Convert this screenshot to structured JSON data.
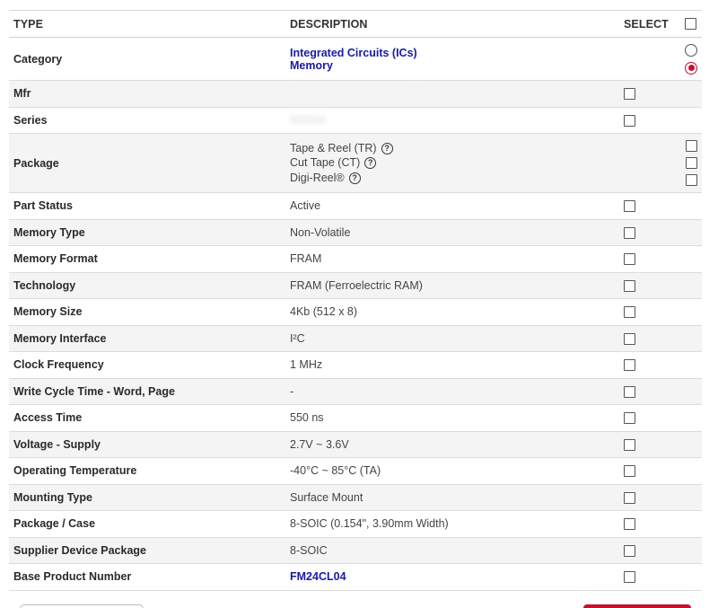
{
  "header": {
    "type": "TYPE",
    "description": "DESCRIPTION",
    "select": "SELECT"
  },
  "rows": {
    "category": {
      "type": "Category",
      "link1": "Integrated Circuits (ICs)",
      "link2": "Memory"
    },
    "mfr": {
      "type": "Mfr",
      "value": ""
    },
    "series": {
      "type": "Series",
      "value": ""
    },
    "package": {
      "type": "Package",
      "opt1": "Tape & Reel (TR)",
      "opt2": "Cut Tape (CT)",
      "opt3": "Digi-Reel®"
    },
    "part_status": {
      "type": "Part Status",
      "value": "Active"
    },
    "memory_type": {
      "type": "Memory Type",
      "value": "Non-Volatile"
    },
    "memory_format": {
      "type": "Memory Format",
      "value": "FRAM"
    },
    "technology": {
      "type": "Technology",
      "value": "FRAM (Ferroelectric RAM)"
    },
    "memory_size": {
      "type": "Memory Size",
      "value": "4Kb (512 x 8)"
    },
    "memory_interface": {
      "type": "Memory Interface",
      "value": "I²C"
    },
    "clock_frequency": {
      "type": "Clock Frequency",
      "value": "1 MHz"
    },
    "write_cycle": {
      "type": "Write Cycle Time - Word, Page",
      "value": "-"
    },
    "access_time": {
      "type": "Access Time",
      "value": "550 ns"
    },
    "voltage": {
      "type": "Voltage - Supply",
      "value": "2.7V ~ 3.6V"
    },
    "op_temp": {
      "type": "Operating Temperature",
      "value": "-40°C ~ 85°C (TA)"
    },
    "mounting": {
      "type": "Mounting Type",
      "value": "Surface Mount"
    },
    "package_case": {
      "type": "Package / Case",
      "value": "8-SOIC (0.154\", 3.90mm Width)"
    },
    "supplier_pkg": {
      "type": "Supplier Device Package",
      "value": "8-SOIC"
    },
    "base_product": {
      "type": "Base Product Number",
      "value": "FM24CL04"
    }
  },
  "icons": {
    "help": "question-circle-icon",
    "accent_color": "#c8102e",
    "link_color": "#1a1aa8"
  }
}
